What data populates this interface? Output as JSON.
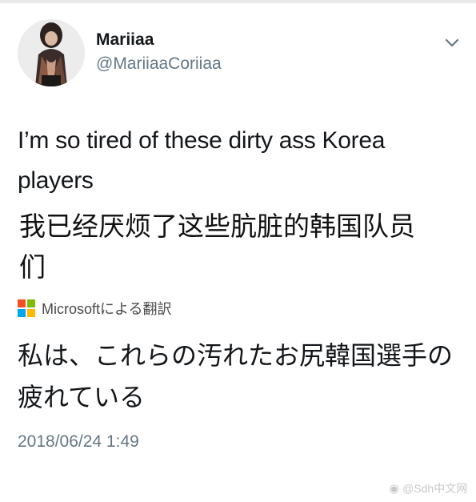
{
  "tweet": {
    "display_name": "Mariiaa",
    "handle": "@MariiaaCoriiaa",
    "menu_icon": "chevron-down-icon",
    "text": "I’m so tired of these dirty ass Korea players",
    "translation_zh": "我已经厌烦了这些肮脏的韩国队员们",
    "translated_by": "Microsoftによる翻訳",
    "translation_ja": "私は、これらの汚れたお尻韓国選手の疲れている",
    "timestamp": "2018/06/24 1:49"
  },
  "watermark": {
    "text": "@Sdh中文网"
  },
  "colors": {
    "text": "#14171a",
    "muted": "#657786",
    "ms_red": "#f25022",
    "ms_green": "#7fba00",
    "ms_blue": "#00a4ef",
    "ms_yellow": "#ffb900"
  }
}
